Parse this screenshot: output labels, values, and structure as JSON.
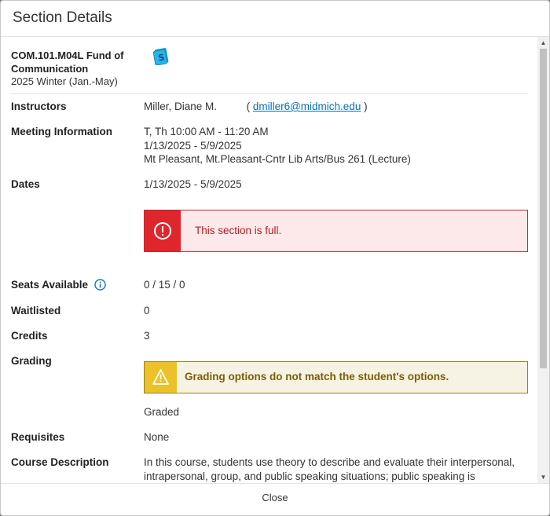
{
  "dialog": {
    "title": "Section Details"
  },
  "course": {
    "title": "COM.101.M04L Fund of Communication",
    "term": "2025 Winter (Jan.-May)",
    "icon": "textbook-icon"
  },
  "instructors": {
    "label": "Instructors",
    "name": "Miller, Diane M.",
    "paren_open": "(",
    "email": "dmiller6@midmich.edu",
    "paren_close": ")"
  },
  "meeting": {
    "label": "Meeting Information",
    "days_time": "T, Th 10:00 AM - 11:20 AM",
    "dates": "1/13/2025 - 5/9/2025",
    "location": "Mt Pleasant, Mt.Pleasant-Cntr Lib Arts/Bus 261 (Lecture)"
  },
  "dates": {
    "label": "Dates",
    "value": "1/13/2025 - 5/9/2025"
  },
  "full_alert": {
    "message": "This section is full.",
    "icon": "error-circle-icon",
    "color": "#e0262d"
  },
  "seats": {
    "label": "Seats Available",
    "value": "0 / 15 / 0",
    "icon": "info-icon"
  },
  "waitlisted": {
    "label": "Waitlisted",
    "value": "0"
  },
  "credits": {
    "label": "Credits",
    "value": "3"
  },
  "grading": {
    "label": "Grading",
    "warning": "Grading options do not match the student's options.",
    "warning_icon": "warning-triangle-icon",
    "value": "Graded"
  },
  "requisites": {
    "label": "Requisites",
    "value": "None"
  },
  "description": {
    "label": "Course Description",
    "line1": "In this course, students use theory to describe and evaluate their interpersonal,",
    "line2": "intrapersonal, group, and public speaking situations; public speaking is"
  },
  "footer": {
    "close_label": "Close"
  }
}
